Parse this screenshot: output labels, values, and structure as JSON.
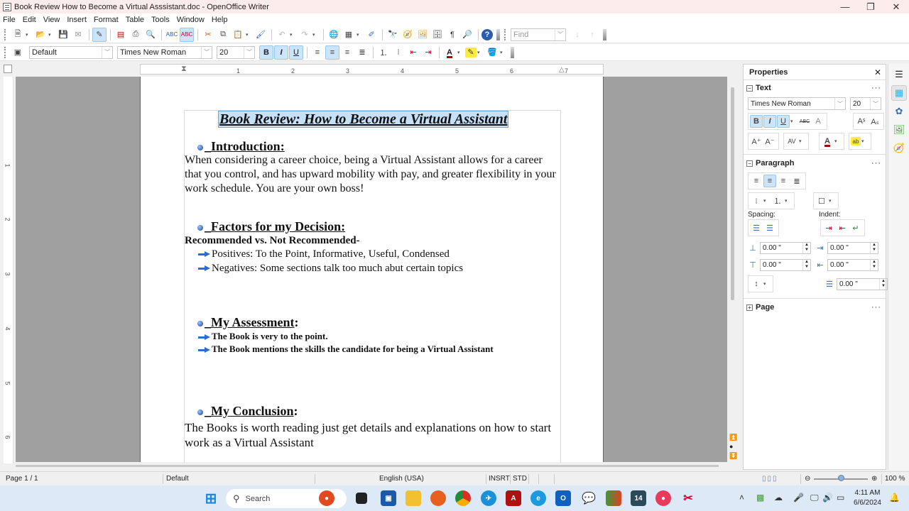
{
  "window": {
    "title": "Book Review How to Become a Virtual Asssistant.doc - OpenOffice Writer",
    "controls": {
      "minimize": "—",
      "restore": "❐",
      "close": "✕"
    }
  },
  "menu": [
    "File",
    "Edit",
    "View",
    "Insert",
    "Format",
    "Table",
    "Tools",
    "Window",
    "Help"
  ],
  "toolbar": {
    "find_placeholder": "Find",
    "paragraph_style": "Default",
    "font_name": "Times New Roman",
    "font_size": "20",
    "bold": "B",
    "italic": "I",
    "underline": "U"
  },
  "ruler": {
    "horizontal": [
      "1",
      "2",
      "3",
      "4",
      "5",
      "6",
      "7"
    ],
    "vertical": [
      "1",
      "2",
      "3",
      "4",
      "5",
      "6"
    ]
  },
  "document": {
    "title": "Book Review: How to Become a Virtual Assistant",
    "sections": [
      {
        "heading": "Introduction:",
        "body": "When considering a career choice, being a Virtual Assistant allows for a career that you control, and has upward mobility with pay, and greater flexibility in your work schedule.  You are your own boss!"
      },
      {
        "heading": "Factors for my Decision:",
        "subheading": "Recommended  vs. Not Recommended-",
        "items": [
          "Positives: To the Point, Informative, Useful, Condensed",
          "Negatives: Some sections talk too much abut certain topics"
        ]
      },
      {
        "heading": "My Assessment",
        "heading_suffix": ":",
        "items": [
          "The Book is very to the point.",
          "The Book mentions the skills the candidate for being a Virtual Assistant"
        ]
      },
      {
        "heading": "My Conclusion",
        "heading_suffix": ":",
        "body": "The Books is worth reading just get details and explanations on how to start work as a Virtual Assistant"
      }
    ]
  },
  "sidebar": {
    "title": "Properties",
    "text_section": "Text",
    "font_name": "Times New Roman",
    "font_size": "20",
    "paragraph_section": "Paragraph",
    "spacing_label": "Spacing:",
    "indent_label": "Indent:",
    "above_spacing": "0.00 \"",
    "below_spacing": "0.00 \"",
    "before_indent": "0.00 \"",
    "after_indent": "0.00 \"",
    "first_line_indent": "0.00 \"",
    "page_section": "Page"
  },
  "statusbar": {
    "page": "Page 1 / 1",
    "page_style": "Default",
    "language": "English (USA)",
    "insert_mode": "INSRT",
    "selection_mode": "STD",
    "zoom": "100 %",
    "zoom_level_percent": 100
  },
  "taskbar": {
    "search_placeholder": "Search",
    "time": "4:11 AM",
    "date": "6/6/2024",
    "calendar_day": "14"
  }
}
